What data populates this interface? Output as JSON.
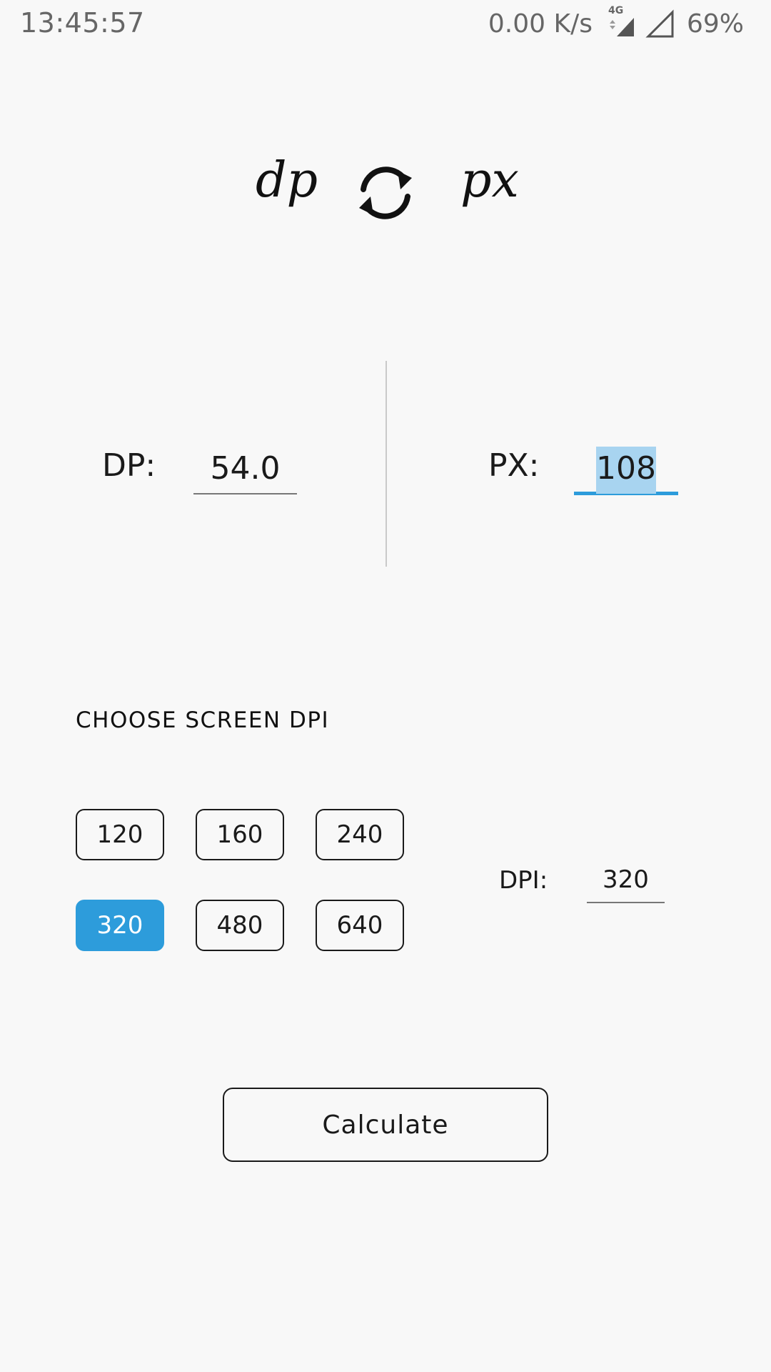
{
  "status_bar": {
    "time": "13:45:57",
    "net_speed": "0.00 K/s",
    "network_type": "4G",
    "battery": "69%"
  },
  "header": {
    "left_unit": "dp",
    "right_unit": "px",
    "swap_icon": "sync-icon"
  },
  "converter": {
    "dp_label": "DP:",
    "dp_value": "54.0",
    "px_label": "PX:",
    "px_value": "108"
  },
  "dpi_section": {
    "title": "CHOOSE SCREEN DPI",
    "options": [
      "120",
      "160",
      "240",
      "320",
      "480",
      "640"
    ],
    "selected": "320",
    "dpi_label": "DPI:",
    "dpi_value": "320"
  },
  "actions": {
    "calculate_label": "Calculate"
  },
  "colors": {
    "accent": "#2d9cdb",
    "selection": "#a8d4f0",
    "background": "#f8f8f8"
  }
}
